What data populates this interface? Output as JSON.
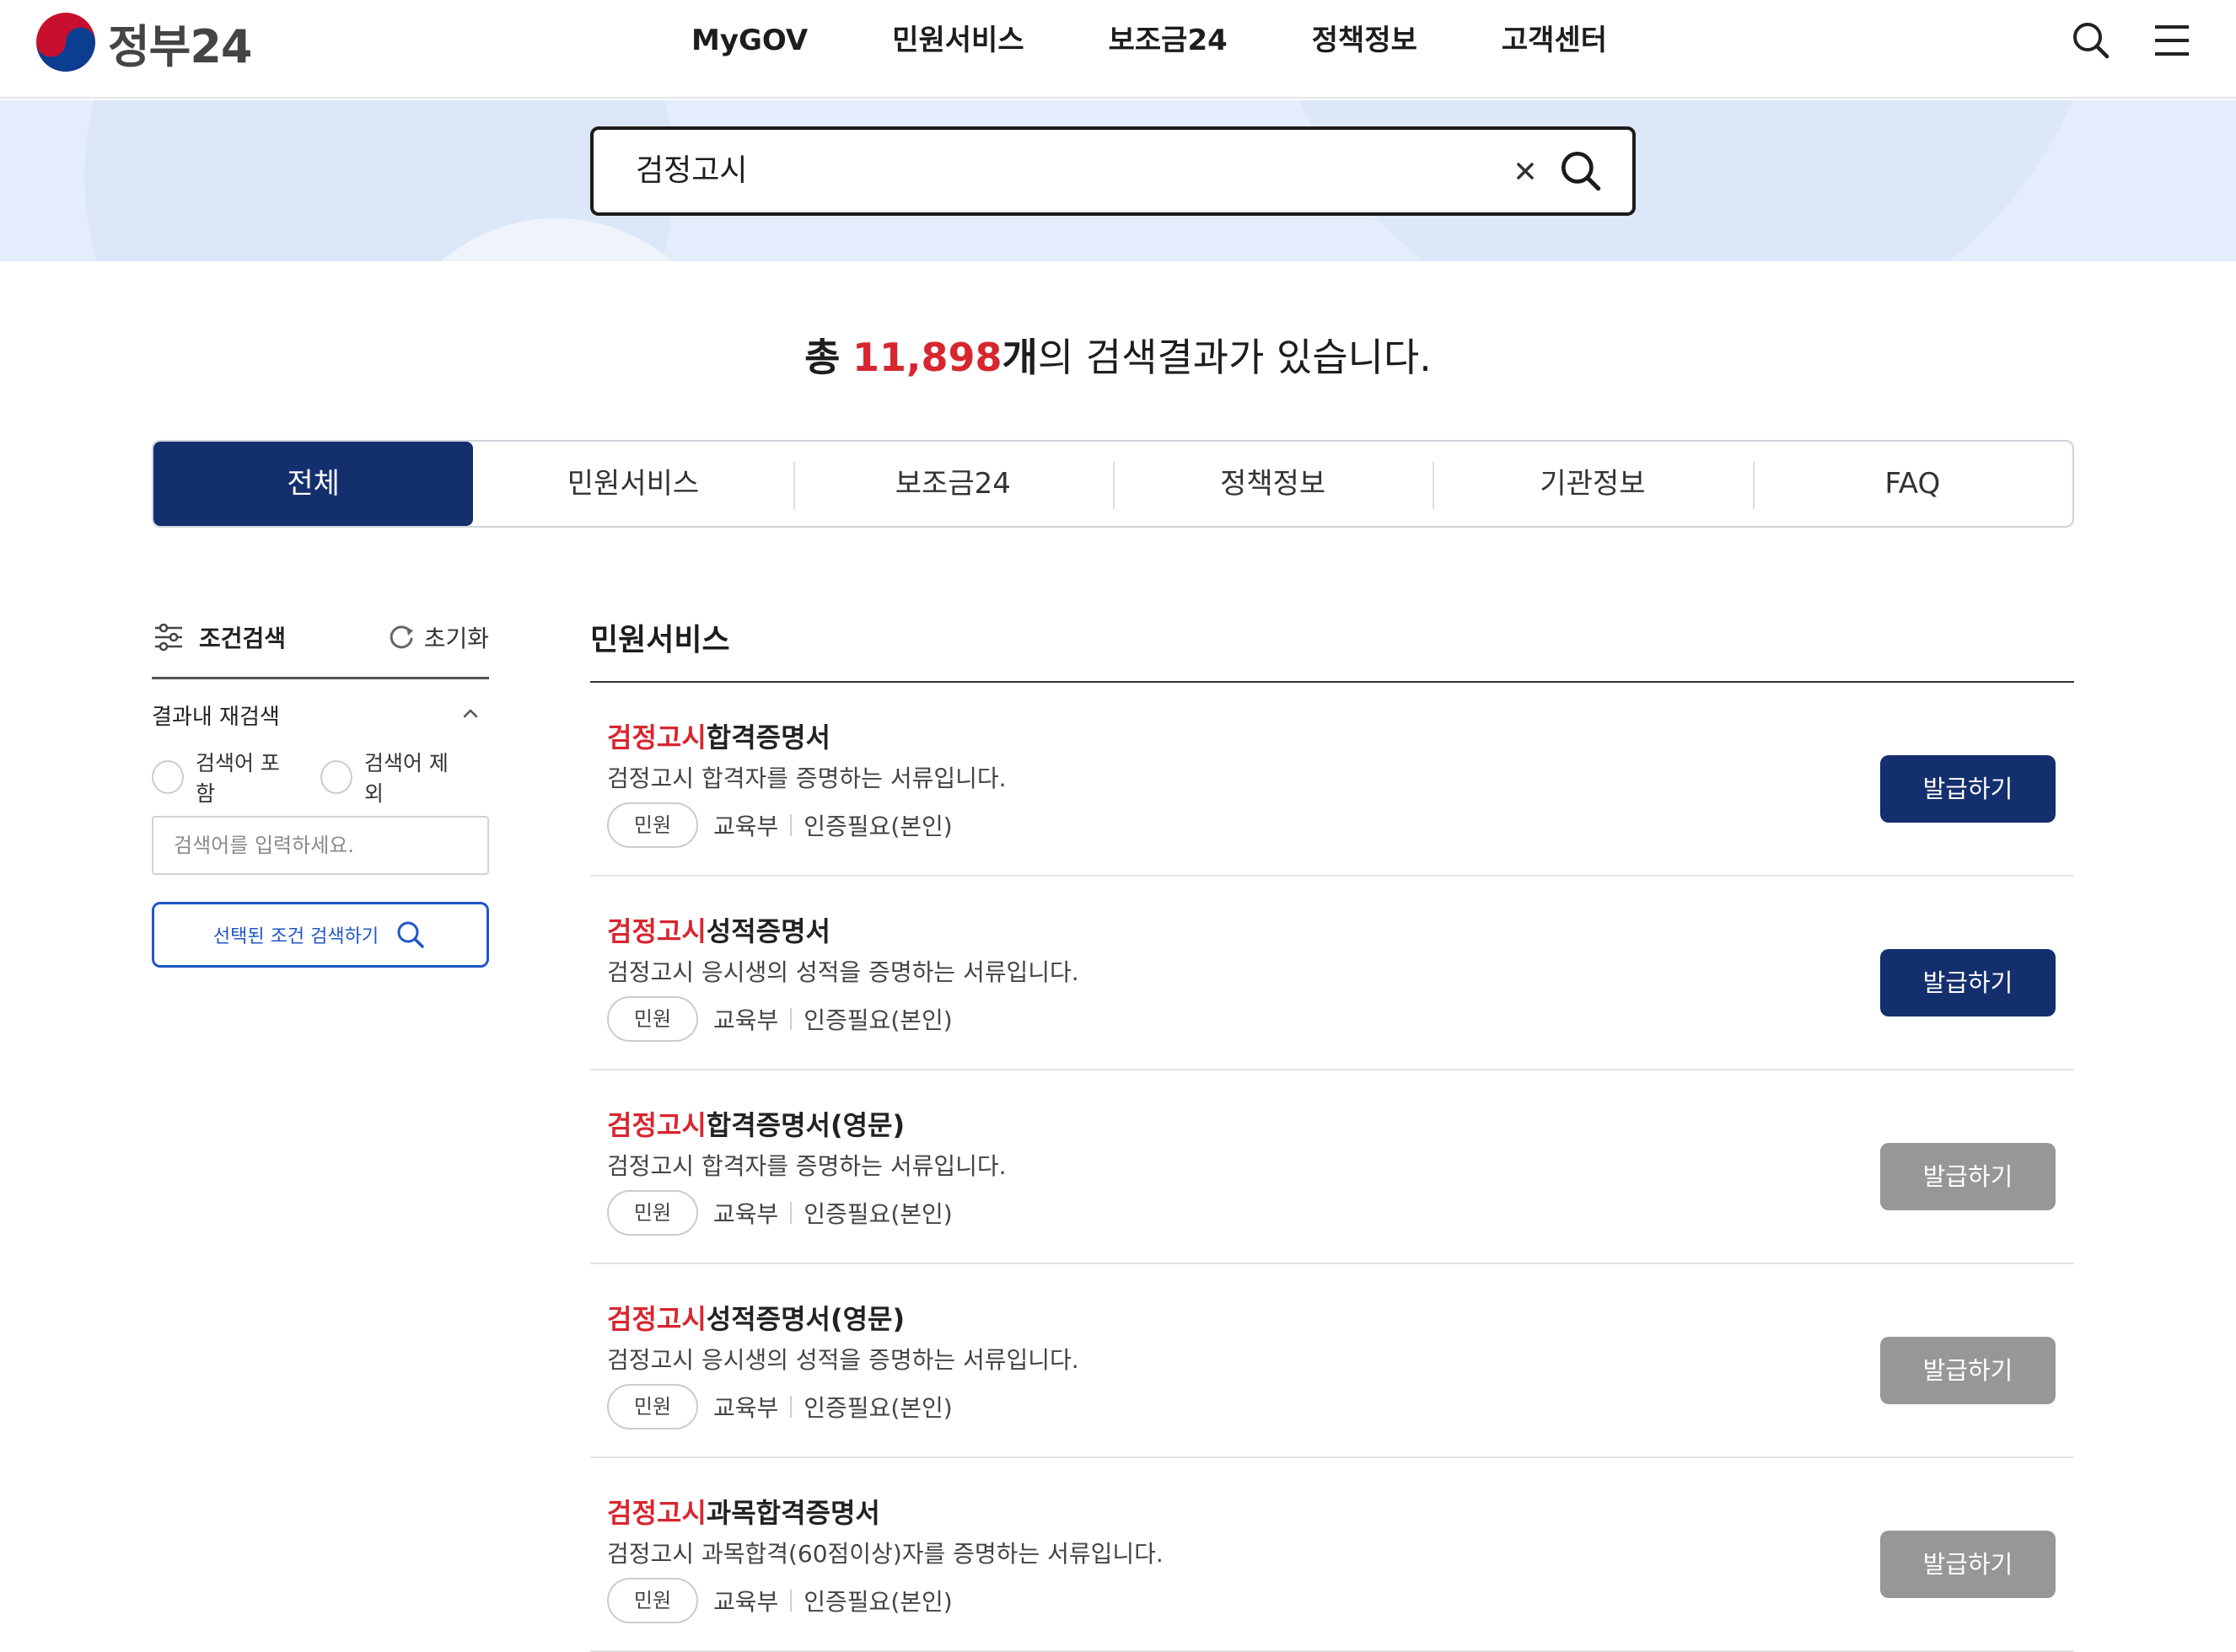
{
  "header": {
    "logo_text": "정부24",
    "nav": [
      "MyGOV",
      "민원서비스",
      "보조금24",
      "정책정보",
      "고객센터"
    ]
  },
  "search": {
    "query": "검정고시"
  },
  "result_count": {
    "prefix": "총",
    "number": "11,898",
    "unit": "개",
    "suffix": "의 검색결과가 있습니다."
  },
  "tabs": [
    "전체",
    "민원서비스",
    "보조금24",
    "정책정보",
    "기관정보",
    "FAQ"
  ],
  "active_tab": "전체",
  "sidebar": {
    "title": "조건검색",
    "reset": "초기화",
    "refine_label": "결과내 재검색",
    "include": "검색어 포함",
    "exclude": "검색어 제외",
    "input_placeholder": "검색어를 입력하세요.",
    "apply_button": "선택된 조건 검색하기"
  },
  "results": {
    "section_title": "민원서비스",
    "items": [
      {
        "highlight": "검정고시",
        "title_rest": "합격증명서",
        "desc": "검정고시 합격자를 증명하는 서류입니다.",
        "chip": "민원",
        "org": "교육부",
        "auth": "인증필요(본인)",
        "button": "발급하기",
        "enabled": true
      },
      {
        "highlight": "검정고시",
        "title_rest": "성적증명서",
        "desc": "검정고시 응시생의 성적을 증명하는 서류입니다.",
        "chip": "민원",
        "org": "교육부",
        "auth": "인증필요(본인)",
        "button": "발급하기",
        "enabled": true
      },
      {
        "highlight": "검정고시",
        "title_rest": "합격증명서(영문)",
        "desc": "검정고시 합격자를 증명하는 서류입니다.",
        "chip": "민원",
        "org": "교육부",
        "auth": "인증필요(본인)",
        "button": "발급하기",
        "enabled": false
      },
      {
        "highlight": "검정고시",
        "title_rest": "성적증명서(영문)",
        "desc": "검정고시 응시생의 성적을 증명하는 서류입니다.",
        "chip": "민원",
        "org": "교육부",
        "auth": "인증필요(본인)",
        "button": "발급하기",
        "enabled": false
      },
      {
        "highlight": "검정고시",
        "title_rest": "과목합격증명서",
        "desc": "검정고시 과목합격(60점이상)자를 증명하는 서류입니다.",
        "chip": "민원",
        "org": "교육부",
        "auth": "인증필요(본인)",
        "button": "발급하기",
        "enabled": false
      }
    ]
  },
  "colors": {
    "primary": "#142f6e",
    "highlight": "#d8262f",
    "disabled_button": "#979797",
    "search_band": "#e4edfb"
  },
  "icons": [
    "taegeuk-logo-icon",
    "search-icon",
    "menu-icon",
    "clear-icon",
    "filter-sliders-icon",
    "refresh-icon",
    "chevron-up-icon"
  ]
}
